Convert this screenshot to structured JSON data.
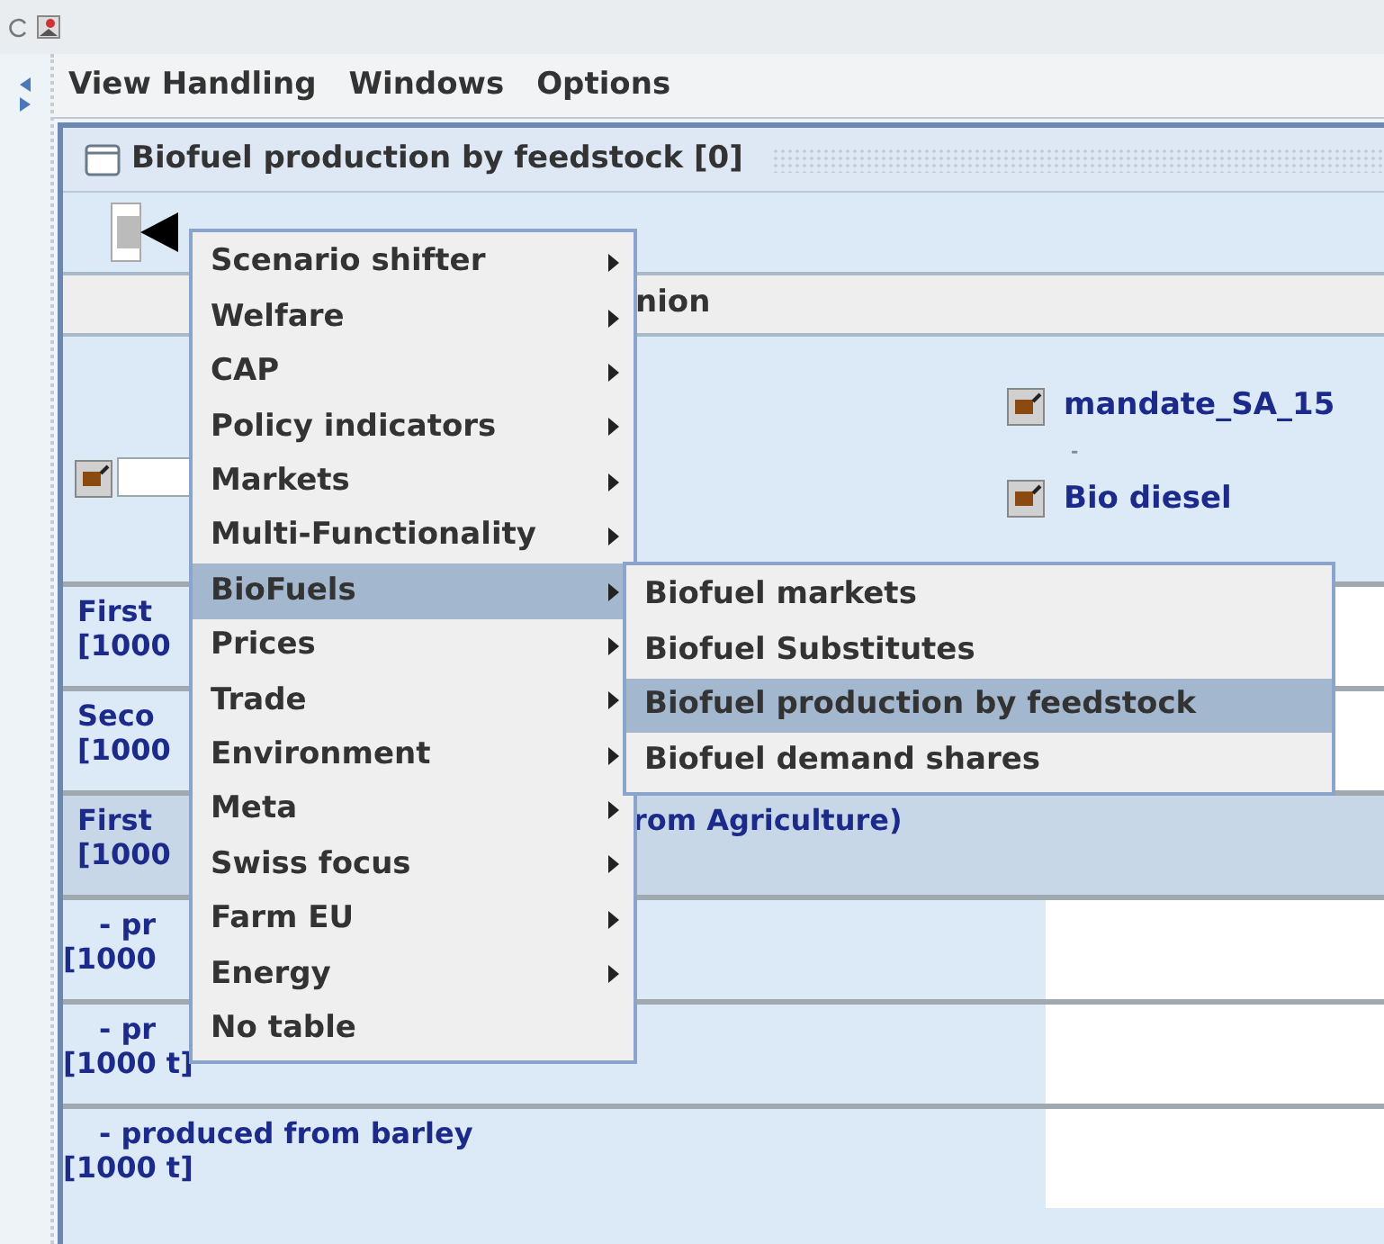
{
  "menubar": [
    "View Handling",
    "Windows",
    "Options"
  ],
  "frame": {
    "title": "Biofuel production by feedstock [0]"
  },
  "region_field": {
    "value": "nion"
  },
  "left_filter": {
    "checked": true
  },
  "filters": [
    {
      "kind": "checkbox",
      "label": "mandate_SA_15",
      "checked": true
    },
    {
      "kind": "text",
      "label": "-"
    },
    {
      "kind": "checkbox",
      "label": "Bio diesel",
      "checked": true
    }
  ],
  "rows": [
    {
      "label": "First",
      "unit": "[1000",
      "selected": false
    },
    {
      "label": "Seco",
      "unit": "[1000",
      "selected": false
    },
    {
      "label": "First",
      "label_after_menu": "rom Agriculture)",
      "unit": "[1000",
      "selected": true,
      "children": [
        {
          "label": "- pr",
          "unit": "[1000",
          "selected": false
        },
        {
          "label": "- pr",
          "unit": "[1000 t]",
          "selected": false
        },
        {
          "label": "- produced from barley",
          "unit": "[1000 t]",
          "selected": false
        }
      ]
    }
  ],
  "menu": {
    "items": [
      {
        "label": "Scenario shifter",
        "submenu": true,
        "selected": false
      },
      {
        "label": "Welfare",
        "submenu": true,
        "selected": false
      },
      {
        "label": "CAP",
        "submenu": true,
        "selected": false
      },
      {
        "label": "Policy indicators",
        "submenu": true,
        "selected": false
      },
      {
        "label": "Markets",
        "submenu": true,
        "selected": false
      },
      {
        "label": "Multi-Functionality",
        "submenu": true,
        "selected": false
      },
      {
        "label": "BioFuels",
        "submenu": true,
        "selected": true
      },
      {
        "label": "Prices",
        "submenu": true,
        "selected": false
      },
      {
        "label": "Trade",
        "submenu": true,
        "selected": false
      },
      {
        "label": "Environment",
        "submenu": true,
        "selected": false
      },
      {
        "label": "Meta",
        "submenu": true,
        "selected": false
      },
      {
        "label": "Swiss focus",
        "submenu": true,
        "selected": false
      },
      {
        "label": "Farm EU",
        "submenu": true,
        "selected": false
      },
      {
        "label": "Energy",
        "submenu": true,
        "selected": false
      },
      {
        "label": "No table",
        "submenu": false,
        "selected": false
      }
    ],
    "submenu": {
      "items": [
        {
          "label": "Biofuel markets",
          "selected": false
        },
        {
          "label": "Biofuel Substitutes",
          "selected": false
        },
        {
          "label": "Biofuel production by feedstock",
          "selected": true
        },
        {
          "label": "Biofuel demand shares",
          "selected": false
        }
      ]
    }
  }
}
